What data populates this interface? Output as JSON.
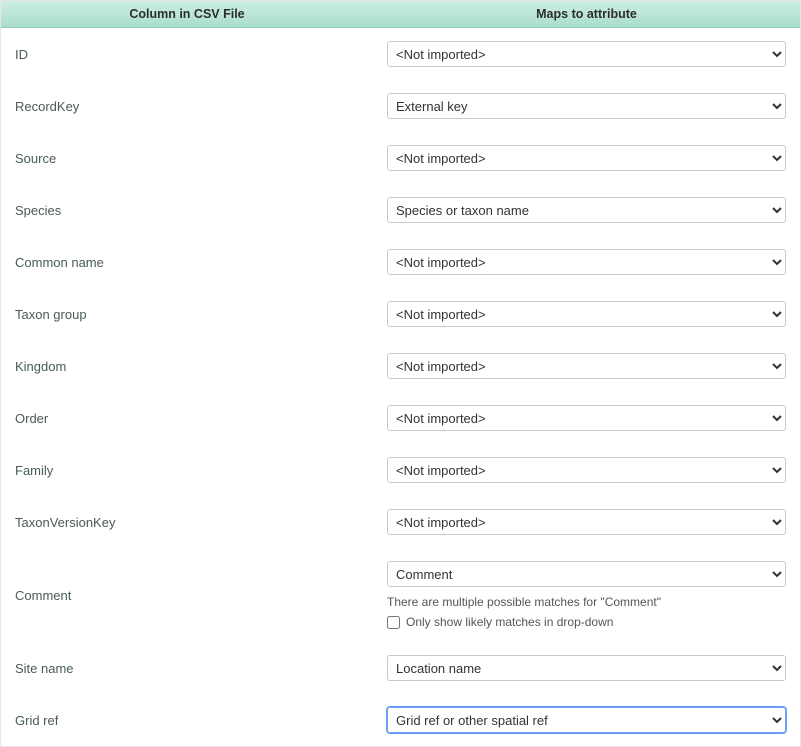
{
  "headers": {
    "col1": "Column in CSV File",
    "col2": "Maps to attribute"
  },
  "not_imported_label": "<Not imported>",
  "note_text": "There are multiple possible matches for \"Comment\"",
  "checkbox_label": "Only show likely matches in drop-down",
  "rows": [
    {
      "label": "ID",
      "selected": "<Not imported>",
      "note": false,
      "focused": false
    },
    {
      "label": "RecordKey",
      "selected": "External key",
      "note": false,
      "focused": false
    },
    {
      "label": "Source",
      "selected": "<Not imported>",
      "note": false,
      "focused": false
    },
    {
      "label": "Species",
      "selected": "Species or taxon name",
      "note": false,
      "focused": false
    },
    {
      "label": "Common name",
      "selected": "<Not imported>",
      "note": false,
      "focused": false
    },
    {
      "label": "Taxon group",
      "selected": "<Not imported>",
      "note": false,
      "focused": false
    },
    {
      "label": "Kingdom",
      "selected": "<Not imported>",
      "note": false,
      "focused": false
    },
    {
      "label": "Order",
      "selected": "<Not imported>",
      "note": false,
      "focused": false
    },
    {
      "label": "Family",
      "selected": "<Not imported>",
      "note": false,
      "focused": false
    },
    {
      "label": "TaxonVersionKey",
      "selected": "<Not imported>",
      "note": false,
      "focused": false
    },
    {
      "label": "Comment",
      "selected": "Comment",
      "note": true,
      "focused": false
    },
    {
      "label": "Site name",
      "selected": "Location name",
      "note": false,
      "focused": false
    },
    {
      "label": "Grid ref",
      "selected": "Grid ref or other spatial ref",
      "note": false,
      "focused": true
    }
  ]
}
